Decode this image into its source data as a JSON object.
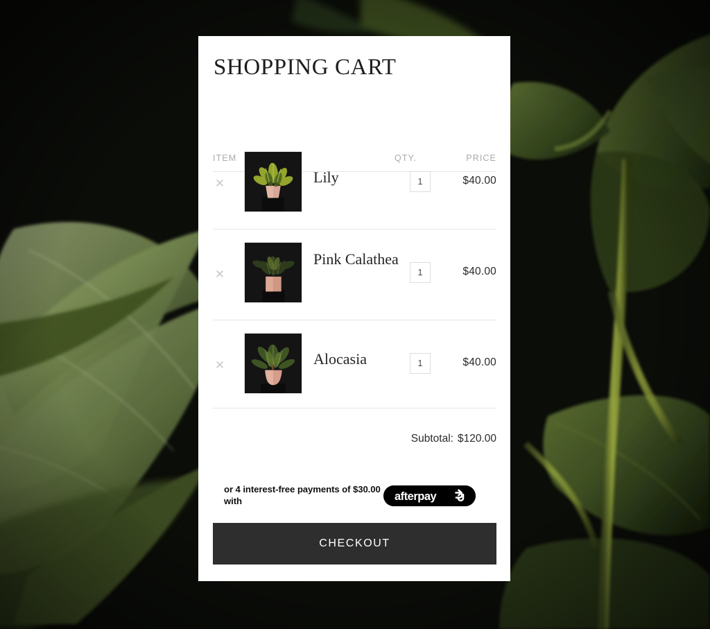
{
  "page": {
    "background_description": "dark photograph of backlit green tropical leaves",
    "background_color": "#0b0d09"
  },
  "cart": {
    "title": "SHOPPING CART",
    "columns": {
      "item": "ITEM",
      "qty": "QTY.",
      "price": "PRICE"
    },
    "remove_icon": "close-icon",
    "items": [
      {
        "name": "Lily",
        "qty": "1",
        "price": "$40.00",
        "thumb_alt": "variegated calathea plant in pink pot on black stand"
      },
      {
        "name": "Pink Calathea",
        "qty": "1",
        "price": "$40.00",
        "thumb_alt": "dark calathea plant in square pink pot on black stand"
      },
      {
        "name": "Alocasia",
        "qty": "1",
        "price": "$40.00",
        "thumb_alt": "alocasia plant in round pink pot on black stand"
      }
    ],
    "subtotal": {
      "label": "Subtotal:",
      "value": "$120.00"
    },
    "afterpay": {
      "text": "or 4 interest-free payments of $30.00 with",
      "logo_text": "afterpay",
      "logo_icon": "afterpay-arrows-icon",
      "badge_color": "#000000"
    },
    "checkout_label": "CHECKOUT",
    "checkout_color": "#2e2e2e"
  }
}
